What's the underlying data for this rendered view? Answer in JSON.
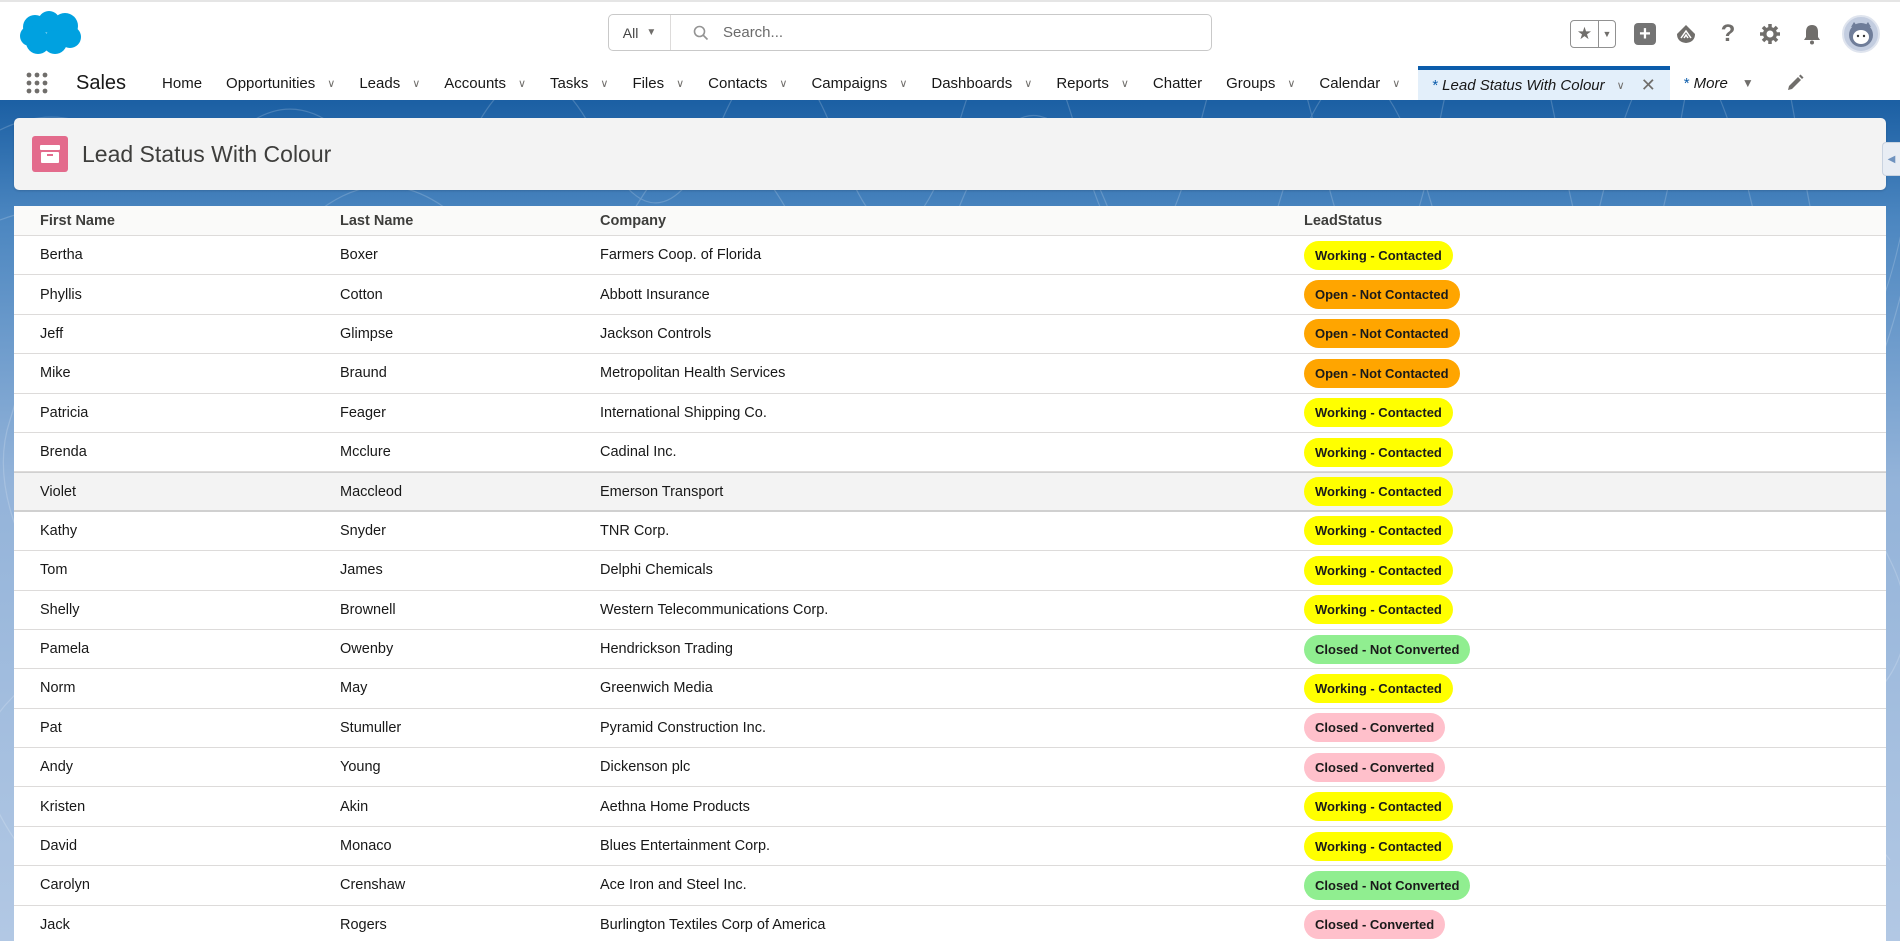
{
  "header": {
    "search_scope": "All",
    "search_placeholder": "Search...",
    "icons": [
      "salesforce-cloud-logo",
      "star-icon",
      "caret-down-icon",
      "plus-icon",
      "trailhead-icon",
      "help-icon",
      "gear-icon",
      "bell-icon",
      "avatar"
    ]
  },
  "nav": {
    "app_name": "Sales",
    "items": [
      {
        "label": "Home",
        "dropdown": false
      },
      {
        "label": "Opportunities",
        "dropdown": true
      },
      {
        "label": "Leads",
        "dropdown": true
      },
      {
        "label": "Accounts",
        "dropdown": true
      },
      {
        "label": "Tasks",
        "dropdown": true
      },
      {
        "label": "Files",
        "dropdown": true
      },
      {
        "label": "Contacts",
        "dropdown": true
      },
      {
        "label": "Campaigns",
        "dropdown": true
      },
      {
        "label": "Dashboards",
        "dropdown": true
      },
      {
        "label": "Reports",
        "dropdown": true
      },
      {
        "label": "Chatter",
        "dropdown": false
      },
      {
        "label": "Groups",
        "dropdown": true
      },
      {
        "label": "Calendar",
        "dropdown": true
      }
    ],
    "active_tab": {
      "prefix": "*",
      "label": "Lead Status With Colour"
    },
    "more": {
      "prefix": "*",
      "label": "More"
    }
  },
  "page": {
    "title": "Lead Status With Colour",
    "title_icon": "archive-box-icon"
  },
  "table": {
    "columns": [
      "First Name",
      "Last Name",
      "Company",
      "LeadStatus"
    ],
    "status_colors": {
      "Working - Contacted": "#ffff00",
      "Open - Not Contacted": "#ffa500",
      "Closed - Not Converted": "#90ee90",
      "Closed - Converted": "#ffc0cb"
    },
    "rows": [
      {
        "first": "Bertha",
        "last": "Boxer",
        "company": "Farmers Coop. of Florida",
        "status": "Working - Contacted"
      },
      {
        "first": "Phyllis",
        "last": "Cotton",
        "company": "Abbott Insurance",
        "status": "Open - Not Contacted"
      },
      {
        "first": "Jeff",
        "last": "Glimpse",
        "company": "Jackson Controls",
        "status": "Open - Not Contacted"
      },
      {
        "first": "Mike",
        "last": "Braund",
        "company": "Metropolitan Health Services",
        "status": "Open - Not Contacted"
      },
      {
        "first": "Patricia",
        "last": "Feager",
        "company": "International Shipping Co.",
        "status": "Working - Contacted"
      },
      {
        "first": "Brenda",
        "last": "Mcclure",
        "company": "Cadinal Inc.",
        "status": "Working - Contacted"
      },
      {
        "first": "Violet",
        "last": "Maccleod",
        "company": "Emerson Transport",
        "status": "Working - Contacted",
        "hover": true
      },
      {
        "first": "Kathy",
        "last": "Snyder",
        "company": "TNR Corp.",
        "status": "Working - Contacted"
      },
      {
        "first": "Tom",
        "last": "James",
        "company": "Delphi Chemicals",
        "status": "Working - Contacted"
      },
      {
        "first": "Shelly",
        "last": "Brownell",
        "company": "Western Telecommunications Corp.",
        "status": "Working - Contacted"
      },
      {
        "first": "Pamela",
        "last": "Owenby",
        "company": "Hendrickson Trading",
        "status": "Closed - Not Converted"
      },
      {
        "first": "Norm",
        "last": "May",
        "company": "Greenwich Media",
        "status": "Working - Contacted"
      },
      {
        "first": "Pat",
        "last": "Stumuller",
        "company": "Pyramid Construction Inc.",
        "status": "Closed - Converted"
      },
      {
        "first": "Andy",
        "last": "Young",
        "company": "Dickenson plc",
        "status": "Closed - Converted"
      },
      {
        "first": "Kristen",
        "last": "Akin",
        "company": "Aethna Home Products",
        "status": "Working - Contacted"
      },
      {
        "first": "David",
        "last": "Monaco",
        "company": "Blues Entertainment Corp.",
        "status": "Working - Contacted"
      },
      {
        "first": "Carolyn",
        "last": "Crenshaw",
        "company": "Ace Iron and Steel Inc.",
        "status": "Closed - Not Converted"
      },
      {
        "first": "Jack",
        "last": "Rogers",
        "company": "Burlington Textiles Corp of America",
        "status": "Closed - Converted"
      }
    ]
  }
}
